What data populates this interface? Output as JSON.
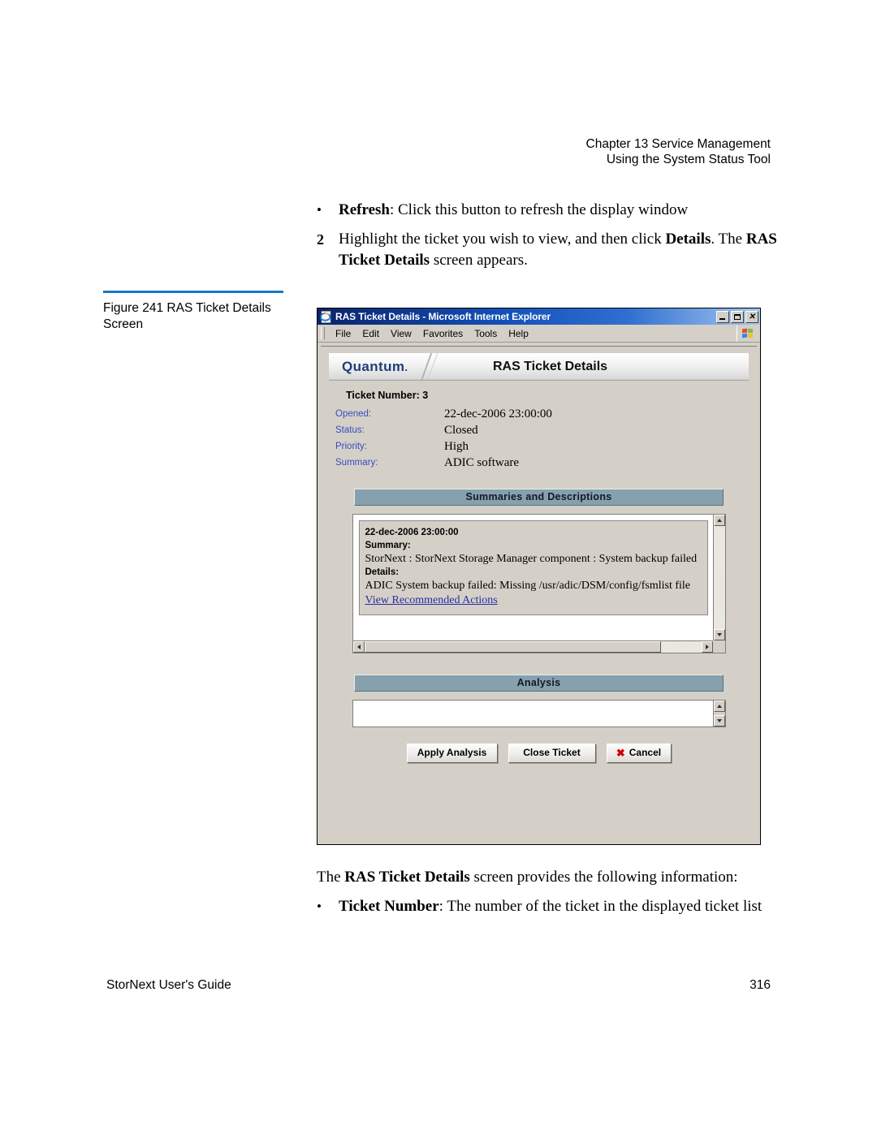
{
  "page_header": {
    "line1": "Chapter 13  Service Management",
    "line2": "Using the System Status Tool"
  },
  "body_top": {
    "bullet_mark": "•",
    "bullet_bold": "Refresh",
    "bullet_rest": ": Click this button to refresh the display window",
    "step_number": "2",
    "step_text_1": "Highlight the ticket you wish to view, and then click ",
    "step_bold_1": "Details",
    "step_text_2": ". The ",
    "step_bold_2": "RAS Ticket Details",
    "step_text_3": " screen appears."
  },
  "figure": {
    "caption": "Figure 241  RAS Ticket Details Screen",
    "rule_color": "#1B78C2"
  },
  "window": {
    "title": "RAS Ticket Details - Microsoft Internet Explorer",
    "icon": "internet-explorer-icon",
    "buttons": {
      "minimize": "minimize-button",
      "maximize": "maximize-button",
      "close": "close-button"
    },
    "menu": [
      "File",
      "Edit",
      "View",
      "Favorites",
      "Tools",
      "Help"
    ]
  },
  "app": {
    "brand": "Quantum",
    "brand_dot": ".",
    "title": "RAS Ticket Details",
    "ticket_number_label": "Ticket Number: 3",
    "fields": [
      {
        "label": "Opened:",
        "value": "22-dec-2006 23:00:00"
      },
      {
        "label": "Status:",
        "value": "Closed"
      },
      {
        "label": "Priority:",
        "value": "High"
      },
      {
        "label": "Summary:",
        "value": "ADIC software"
      }
    ],
    "summaries_section": {
      "header": "Summaries and Descriptions",
      "entry": {
        "timestamp": "22-dec-2006 23:00:00",
        "summary_label": "Summary:",
        "summary_text": "StorNext : StorNext Storage Manager component : System backup failed",
        "details_label": "Details:",
        "details_text": "ADIC System backup failed: Missing /usr/adic/DSM/config/fsmlist file",
        "link": "View Recommended Actions"
      }
    },
    "analysis_section": {
      "header": "Analysis",
      "value": ""
    },
    "buttons": {
      "apply": "Apply Analysis",
      "close_ticket": "Close Ticket",
      "cancel": "Cancel",
      "cancel_icon": "✖"
    },
    "colors": {
      "section_header_bg": "#86a0ad",
      "field_label": "#3a4bbf",
      "link": "#2b2ba8",
      "brand": "#1F3D7A",
      "cancel_x": "#d30000"
    }
  },
  "body_bottom": {
    "para_text_1": "The ",
    "para_bold": "RAS Ticket Details",
    "para_text_2": " screen provides the following information:",
    "bullet_mark": "•",
    "bullet_bold": "Ticket Number",
    "bullet_rest": ": The number of the ticket in the displayed ticket list"
  },
  "footer": {
    "left": "StorNext User's Guide",
    "right": "316"
  }
}
